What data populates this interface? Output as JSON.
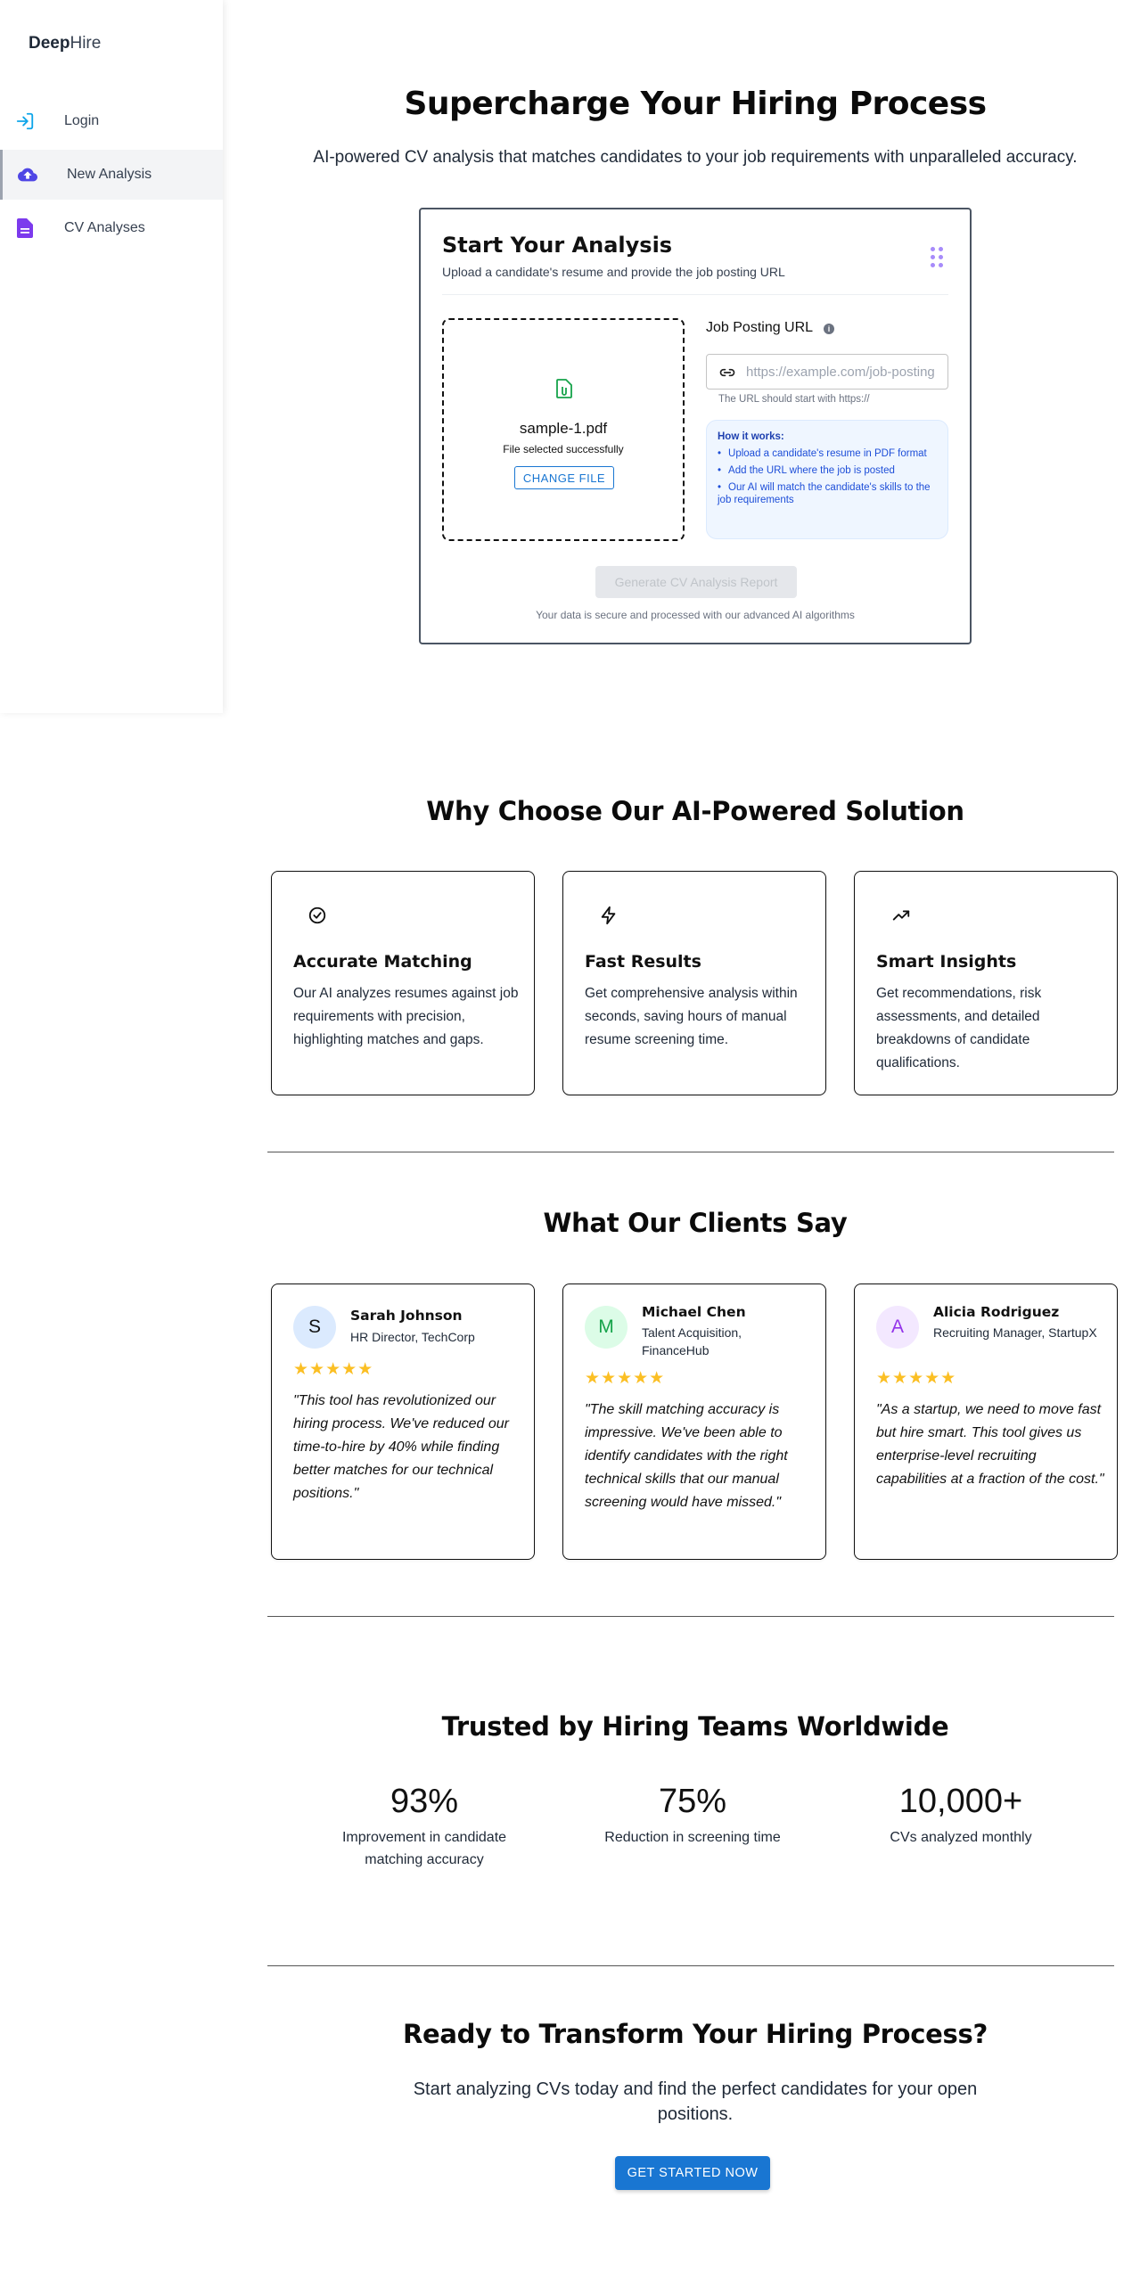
{
  "sidebar": {
    "brand_bold": "Deep",
    "brand_light": "Hire",
    "items": [
      {
        "label": "Login",
        "icon": "login-icon"
      },
      {
        "label": "New Analysis",
        "icon": "cloud-upload-icon",
        "active": true
      },
      {
        "label": "CV Analyses",
        "icon": "document-icon"
      }
    ]
  },
  "hero": {
    "title": "Supercharge Your Hiring Process",
    "subtitle": "AI-powered CV analysis that matches candidates to your job requirements with unparalleled accuracy."
  },
  "analysis_card": {
    "title": "Start Your Analysis",
    "subtitle": "Upload a candidate's resume and provide the job posting URL",
    "file": {
      "name": "sample-1.pdf",
      "status": "File selected successfully",
      "change_label": "CHANGE FILE"
    },
    "url": {
      "label": "Job Posting URL",
      "value": "",
      "placeholder": "https://example.com/job-posting",
      "help": "The URL should start with https://"
    },
    "how_it_works": {
      "heading": "How it works:",
      "steps": [
        "Upload a candidate's resume in PDF format",
        "Add the URL where the job is posted",
        "Our AI will match the candidate's skills to the job requirements"
      ]
    },
    "generate_label": "Generate CV Analysis Report",
    "secure_note": "Your data is secure and processed with our advanced AI algorithms"
  },
  "features": {
    "title": "Why Choose Our AI-Powered Solution",
    "items": [
      {
        "icon": "check-circle-icon",
        "title": "Accurate Matching",
        "desc": "Our AI analyzes resumes against job requirements with precision, highlighting matches and gaps."
      },
      {
        "icon": "lightning-icon",
        "title": "Fast Results",
        "desc": "Get comprehensive analysis within seconds, saving hours of manual resume screening time."
      },
      {
        "icon": "trending-up-icon",
        "title": "Smart Insights",
        "desc": "Get recommendations, risk assessments, and detailed breakdowns of candidate qualifications."
      }
    ]
  },
  "testimonials": {
    "title": "What Our Clients Say",
    "items": [
      {
        "initial": "S",
        "name": "Sarah Johnson",
        "role": "HR Director, TechCorp",
        "rating": 5,
        "stars": "★★★★★",
        "quote": "\"This tool has revolutionized our hiring process. We've reduced our time-to-hire by 40% while finding better matches for our technical positions.\""
      },
      {
        "initial": "M",
        "name": "Michael Chen",
        "role": "Talent Acquisition, FinanceHub",
        "rating": 5,
        "stars": "★★★★★",
        "quote": "\"The skill matching accuracy is impressive. We've been able to identify candidates with the right technical skills that our manual screening would have missed.\""
      },
      {
        "initial": "A",
        "name": "Alicia Rodriguez",
        "role": "Recruiting Manager, StartupX",
        "rating": 5,
        "stars": "★★★★★",
        "quote": "\"As a startup, we need to move fast but hire smart. This tool gives us enterprise-level recruiting capabilities at a fraction of the cost.\""
      }
    ]
  },
  "stats": {
    "title": "Trusted by Hiring Teams Worldwide",
    "items": [
      {
        "value": "93%",
        "label": "Improvement in candidate matching accuracy"
      },
      {
        "value": "75%",
        "label": "Reduction in screening time"
      },
      {
        "value": "10,000+",
        "label": "CVs analyzed monthly"
      }
    ]
  },
  "cta": {
    "title": "Ready to Transform Your Hiring Process?",
    "subtitle": "Start analyzing CVs today and find the perfect candidates for your open positions.",
    "button": "GET STARTED NOW"
  },
  "colors": {
    "primary": "#1976d2",
    "star": "#fbbf24",
    "avatar_s_bg": "#dbeafe",
    "avatar_m_bg": "#dcfce7",
    "avatar_a_bg": "#f3e8ff"
  }
}
